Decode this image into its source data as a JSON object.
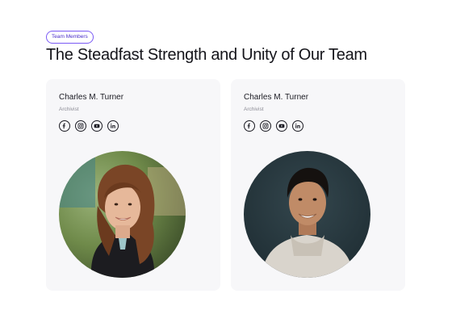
{
  "header": {
    "badge": "Team Members",
    "title": "The Steadfast Strength and Unity of Our Team"
  },
  "members": [
    {
      "name": "Charles M. Turner",
      "role": "Archivist",
      "socials": [
        "facebook-icon",
        "instagram-icon",
        "youtube-icon",
        "linkedin-icon"
      ]
    },
    {
      "name": "Charles M. Turner",
      "role": "Archivist",
      "socials": [
        "facebook-icon",
        "instagram-icon",
        "youtube-icon",
        "linkedin-icon"
      ]
    }
  ],
  "colors": {
    "card_bg": "#f7f7f9",
    "badge_border": "#7a5af5",
    "text": "#14141a",
    "muted": "#8b8b95"
  }
}
